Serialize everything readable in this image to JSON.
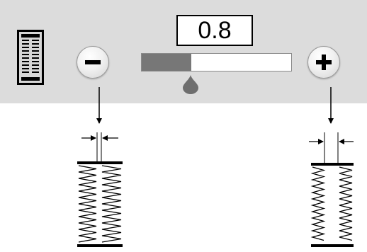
{
  "stitch_setting": {
    "value": "0.8",
    "level_fraction": 0.33,
    "decrease_icon": "minus-icon",
    "increase_icon": "plus-icon",
    "stitch_icon": "buttonhole-stitch-icon",
    "marker_icon": "drop-marker-icon"
  },
  "colors": {
    "panel": "#dcdcdc",
    "slider_fill": "#777777",
    "button_face": "#f1f1f1"
  },
  "illustrations": {
    "narrow": "buttonhole-narrow-slit-illustration",
    "wide": "buttonhole-wide-slit-illustration"
  }
}
